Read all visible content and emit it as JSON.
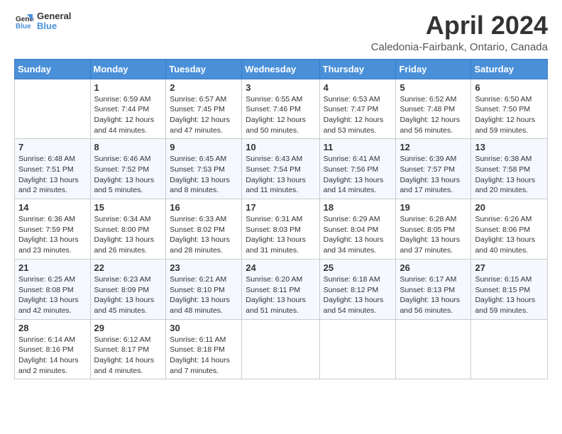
{
  "header": {
    "logo_line1": "General",
    "logo_line2": "Blue",
    "month": "April 2024",
    "location": "Caledonia-Fairbank, Ontario, Canada"
  },
  "weekdays": [
    "Sunday",
    "Monday",
    "Tuesday",
    "Wednesday",
    "Thursday",
    "Friday",
    "Saturday"
  ],
  "weeks": [
    [
      {
        "day": "",
        "info": ""
      },
      {
        "day": "1",
        "info": "Sunrise: 6:59 AM\nSunset: 7:44 PM\nDaylight: 12 hours\nand 44 minutes."
      },
      {
        "day": "2",
        "info": "Sunrise: 6:57 AM\nSunset: 7:45 PM\nDaylight: 12 hours\nand 47 minutes."
      },
      {
        "day": "3",
        "info": "Sunrise: 6:55 AM\nSunset: 7:46 PM\nDaylight: 12 hours\nand 50 minutes."
      },
      {
        "day": "4",
        "info": "Sunrise: 6:53 AM\nSunset: 7:47 PM\nDaylight: 12 hours\nand 53 minutes."
      },
      {
        "day": "5",
        "info": "Sunrise: 6:52 AM\nSunset: 7:48 PM\nDaylight: 12 hours\nand 56 minutes."
      },
      {
        "day": "6",
        "info": "Sunrise: 6:50 AM\nSunset: 7:50 PM\nDaylight: 12 hours\nand 59 minutes."
      }
    ],
    [
      {
        "day": "7",
        "info": "Sunrise: 6:48 AM\nSunset: 7:51 PM\nDaylight: 13 hours\nand 2 minutes."
      },
      {
        "day": "8",
        "info": "Sunrise: 6:46 AM\nSunset: 7:52 PM\nDaylight: 13 hours\nand 5 minutes."
      },
      {
        "day": "9",
        "info": "Sunrise: 6:45 AM\nSunset: 7:53 PM\nDaylight: 13 hours\nand 8 minutes."
      },
      {
        "day": "10",
        "info": "Sunrise: 6:43 AM\nSunset: 7:54 PM\nDaylight: 13 hours\nand 11 minutes."
      },
      {
        "day": "11",
        "info": "Sunrise: 6:41 AM\nSunset: 7:56 PM\nDaylight: 13 hours\nand 14 minutes."
      },
      {
        "day": "12",
        "info": "Sunrise: 6:39 AM\nSunset: 7:57 PM\nDaylight: 13 hours\nand 17 minutes."
      },
      {
        "day": "13",
        "info": "Sunrise: 6:38 AM\nSunset: 7:58 PM\nDaylight: 13 hours\nand 20 minutes."
      }
    ],
    [
      {
        "day": "14",
        "info": "Sunrise: 6:36 AM\nSunset: 7:59 PM\nDaylight: 13 hours\nand 23 minutes."
      },
      {
        "day": "15",
        "info": "Sunrise: 6:34 AM\nSunset: 8:00 PM\nDaylight: 13 hours\nand 26 minutes."
      },
      {
        "day": "16",
        "info": "Sunrise: 6:33 AM\nSunset: 8:02 PM\nDaylight: 13 hours\nand 28 minutes."
      },
      {
        "day": "17",
        "info": "Sunrise: 6:31 AM\nSunset: 8:03 PM\nDaylight: 13 hours\nand 31 minutes."
      },
      {
        "day": "18",
        "info": "Sunrise: 6:29 AM\nSunset: 8:04 PM\nDaylight: 13 hours\nand 34 minutes."
      },
      {
        "day": "19",
        "info": "Sunrise: 6:28 AM\nSunset: 8:05 PM\nDaylight: 13 hours\nand 37 minutes."
      },
      {
        "day": "20",
        "info": "Sunrise: 6:26 AM\nSunset: 8:06 PM\nDaylight: 13 hours\nand 40 minutes."
      }
    ],
    [
      {
        "day": "21",
        "info": "Sunrise: 6:25 AM\nSunset: 8:08 PM\nDaylight: 13 hours\nand 42 minutes."
      },
      {
        "day": "22",
        "info": "Sunrise: 6:23 AM\nSunset: 8:09 PM\nDaylight: 13 hours\nand 45 minutes."
      },
      {
        "day": "23",
        "info": "Sunrise: 6:21 AM\nSunset: 8:10 PM\nDaylight: 13 hours\nand 48 minutes."
      },
      {
        "day": "24",
        "info": "Sunrise: 6:20 AM\nSunset: 8:11 PM\nDaylight: 13 hours\nand 51 minutes."
      },
      {
        "day": "25",
        "info": "Sunrise: 6:18 AM\nSunset: 8:12 PM\nDaylight: 13 hours\nand 54 minutes."
      },
      {
        "day": "26",
        "info": "Sunrise: 6:17 AM\nSunset: 8:13 PM\nDaylight: 13 hours\nand 56 minutes."
      },
      {
        "day": "27",
        "info": "Sunrise: 6:15 AM\nSunset: 8:15 PM\nDaylight: 13 hours\nand 59 minutes."
      }
    ],
    [
      {
        "day": "28",
        "info": "Sunrise: 6:14 AM\nSunset: 8:16 PM\nDaylight: 14 hours\nand 2 minutes."
      },
      {
        "day": "29",
        "info": "Sunrise: 6:12 AM\nSunset: 8:17 PM\nDaylight: 14 hours\nand 4 minutes."
      },
      {
        "day": "30",
        "info": "Sunrise: 6:11 AM\nSunset: 8:18 PM\nDaylight: 14 hours\nand 7 minutes."
      },
      {
        "day": "",
        "info": ""
      },
      {
        "day": "",
        "info": ""
      },
      {
        "day": "",
        "info": ""
      },
      {
        "day": "",
        "info": ""
      }
    ]
  ]
}
